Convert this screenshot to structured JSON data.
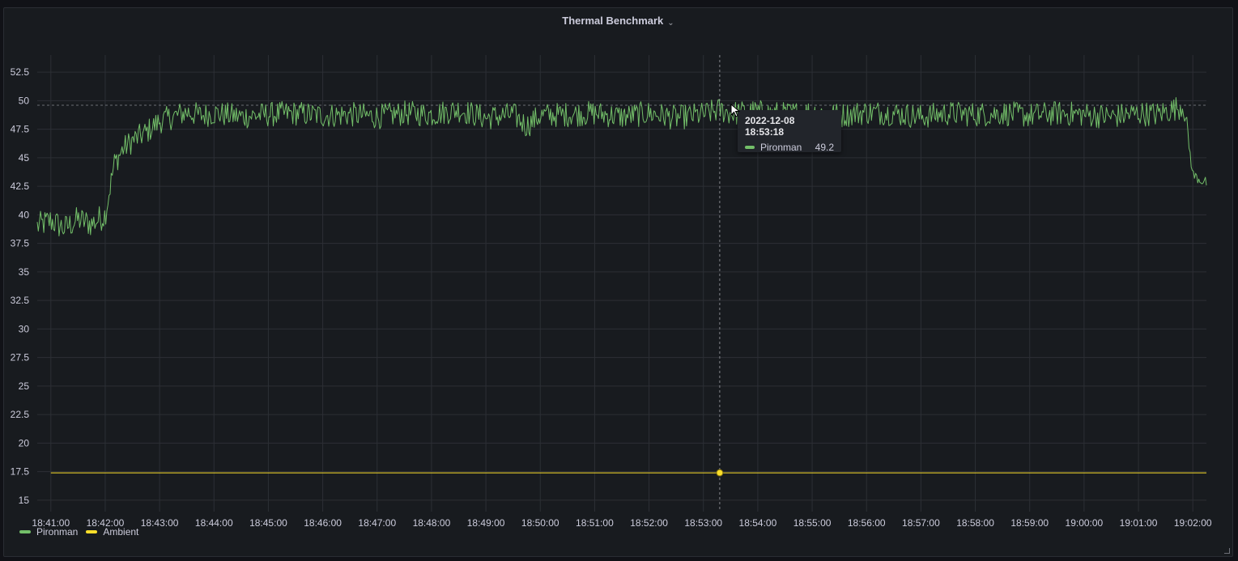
{
  "panel": {
    "title": "Thermal Benchmark",
    "menu_icon": "chevron-down-icon"
  },
  "colors": {
    "pironman": "#73bf69",
    "ambient": "#fade2a",
    "grid": "#2c2f35",
    "axis_text": "#ccccdc"
  },
  "tooltip": {
    "time": "2022-12-08 18:53:18",
    "series": "Pironman",
    "value": "49.2"
  },
  "chart_data": {
    "type": "line",
    "xlabel": "",
    "ylabel": "",
    "x_start": "18:40:45",
    "x_end": "19:02:15",
    "xticks": [
      "18:41:00",
      "18:42:00",
      "18:43:00",
      "18:44:00",
      "18:45:00",
      "18:46:00",
      "18:47:00",
      "18:48:00",
      "18:49:00",
      "18:50:00",
      "18:51:00",
      "18:52:00",
      "18:53:00",
      "18:54:00",
      "18:55:00",
      "18:56:00",
      "18:57:00",
      "18:58:00",
      "18:59:00",
      "19:00:00",
      "19:01:00",
      "19:02:00"
    ],
    "yticks": [
      "15",
      "17.5",
      "20",
      "22.5",
      "25",
      "27.5",
      "30",
      "32.5",
      "35",
      "37.5",
      "40",
      "42.5",
      "45",
      "47.5",
      "50",
      "52.5"
    ],
    "ylim": [
      14,
      54
    ],
    "threshold": 49.6,
    "grid": true,
    "legend_position": "bottom-left",
    "series": [
      {
        "name": "Pironman",
        "x": [
          "18:40:45",
          "18:41:00",
          "18:41:15",
          "18:41:30",
          "18:41:45",
          "18:42:00",
          "18:42:10",
          "18:42:20",
          "18:42:30",
          "18:42:45",
          "18:43:00",
          "18:43:15",
          "18:43:30",
          "18:43:45",
          "18:44:00",
          "18:44:30",
          "18:45:00",
          "18:45:30",
          "18:46:00",
          "18:46:30",
          "18:47:00",
          "18:47:30",
          "18:48:00",
          "18:48:30",
          "18:49:00",
          "18:49:30",
          "18:49:45",
          "18:50:00",
          "18:50:30",
          "18:51:00",
          "18:51:30",
          "18:52:00",
          "18:52:30",
          "18:53:00",
          "18:53:18",
          "18:53:30",
          "18:54:00",
          "18:54:30",
          "18:55:00",
          "18:55:30",
          "18:56:00",
          "18:56:30",
          "18:57:00",
          "18:57:30",
          "18:58:00",
          "18:58:30",
          "18:59:00",
          "18:59:30",
          "19:00:00",
          "19:00:30",
          "19:01:00",
          "19:01:20",
          "19:01:40",
          "19:01:50",
          "19:02:00",
          "19:02:10",
          "19:02:15"
        ],
        "y": [
          39.0,
          39.5,
          38.8,
          39.6,
          39.2,
          40.0,
          44.5,
          45.8,
          46.5,
          47.2,
          48.2,
          48.6,
          49.0,
          48.7,
          48.9,
          48.6,
          48.8,
          48.9,
          48.7,
          48.8,
          48.6,
          48.9,
          48.8,
          49.2,
          48.5,
          48.8,
          47.8,
          48.7,
          48.8,
          48.9,
          48.6,
          48.9,
          48.5,
          48.8,
          49.2,
          48.9,
          49.0,
          48.8,
          49.0,
          48.7,
          49.0,
          48.9,
          48.6,
          48.9,
          48.8,
          48.9,
          48.7,
          48.9,
          48.8,
          48.6,
          48.9,
          48.8,
          49.3,
          49.6,
          43.5,
          43.0,
          42.8
        ]
      },
      {
        "name": "Ambient",
        "x": [
          "18:41:00",
          "19:02:15"
        ],
        "y": [
          17.4,
          17.4
        ]
      }
    ]
  }
}
